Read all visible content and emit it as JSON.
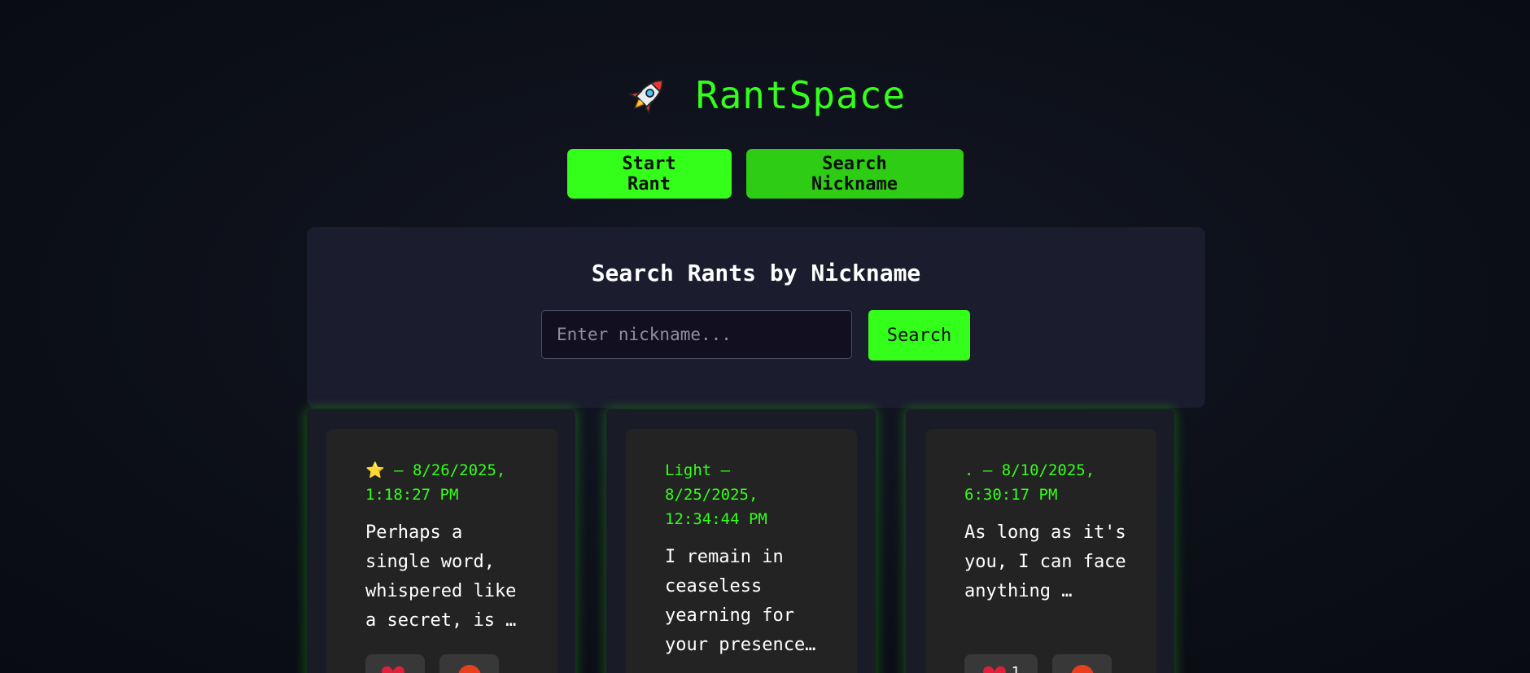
{
  "app": {
    "title": "RantSpace",
    "icon": "rocket-icon"
  },
  "nav": {
    "start_label": "Start Rant",
    "search_nickname_label": "Search Nickname"
  },
  "search": {
    "heading": "Search Rants by Nickname",
    "placeholder": "Enter nickname...",
    "value": "",
    "button_label": "Search"
  },
  "rants": [
    {
      "meta": "⭐ – 8/26/2025, 1:18:27 PM",
      "text": "Perhaps a single word, whispered like a secret, is …",
      "likes": "",
      "reaction_icon": "red-circle-icon"
    },
    {
      "meta": "Light – 8/25/2025, 12:34:44 PM",
      "text": "I remain in ceaseless yearning for your presence…",
      "likes": "",
      "reaction_icon": "red-circle-icon"
    },
    {
      "meta": ". – 8/10/2025, 6:30:17 PM",
      "text": "As long as it's you, I can face anything …",
      "likes": "1",
      "reaction_icon": "red-circle-icon"
    }
  ],
  "colors": {
    "accent": "#33ff1a",
    "panel": "#1b1c2e",
    "card": "#232323"
  }
}
